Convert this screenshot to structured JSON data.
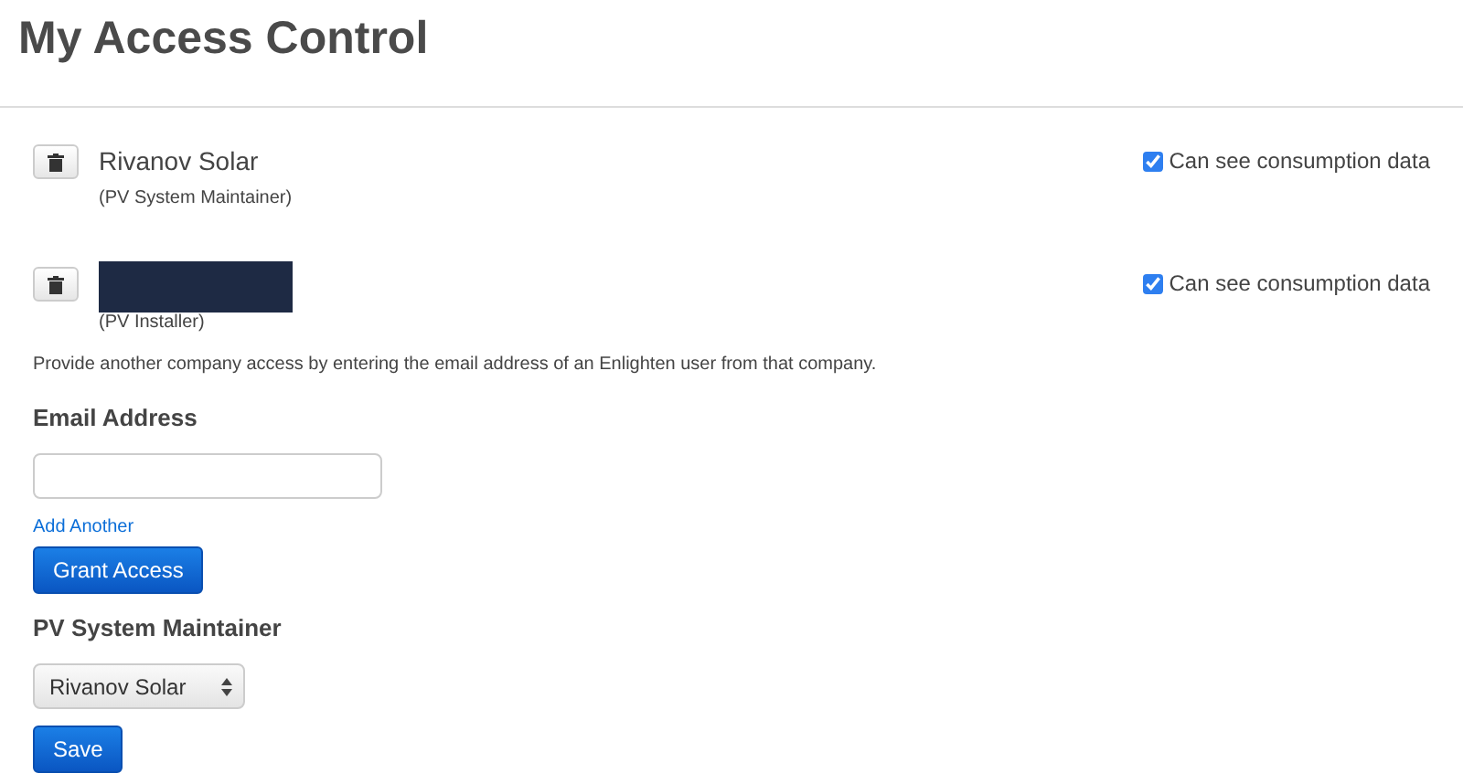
{
  "page": {
    "title": "My Access Control"
  },
  "companies": [
    {
      "kind": "named",
      "name": "Rivanov Solar",
      "role": "(PV System Maintainer)",
      "consumption": {
        "label": "Can see consumption data",
        "checked": true
      }
    },
    {
      "kind": "redacted",
      "role": "(PV Installer)",
      "consumption": {
        "label": "Can see consumption data",
        "checked": true
      }
    }
  ],
  "instructions": "Provide another company access by entering the email address of an Enlighten user from that company.",
  "email": {
    "label": "Email Address"
  },
  "add_another": "Add Another",
  "grant_button": "Grant Access",
  "maintainer": {
    "label": "PV System Maintainer",
    "selected_option": "Rivanov Solar"
  },
  "save_button": "Save"
}
